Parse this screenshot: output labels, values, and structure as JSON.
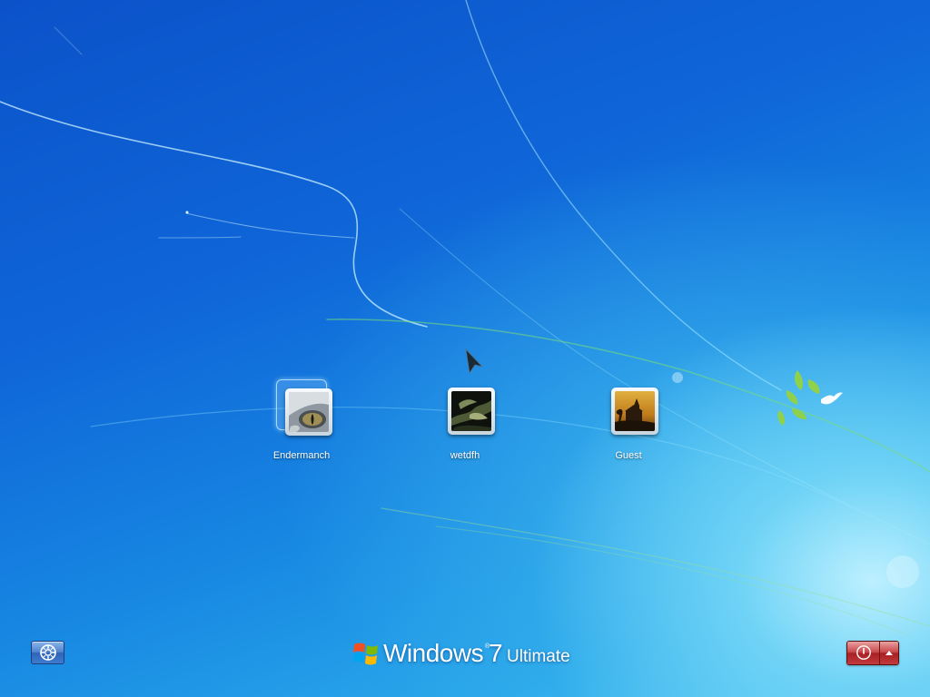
{
  "users": [
    {
      "name": "Endermanch",
      "selected": true,
      "avatar_icon": "cat-eye-avatar"
    },
    {
      "name": "wetdfh",
      "selected": false,
      "avatar_icon": "tree-avatar"
    },
    {
      "name": "Guest",
      "selected": false,
      "avatar_icon": "chapel-avatar"
    }
  ],
  "branding": {
    "product": "Windows",
    "trademark": "®",
    "version": "7",
    "edition": "Ultimate"
  },
  "controls": {
    "ease_of_access_icon": "ease-of-access-icon",
    "power_icon": "power-icon",
    "power_options_icon": "chevron-up-icon"
  },
  "colors": {
    "background_primary": "#0f66d8",
    "background_glow": "#6fd3f6",
    "power_button": "#c8474a",
    "ease_button": "#4f83cd",
    "text": "#ffffff"
  }
}
